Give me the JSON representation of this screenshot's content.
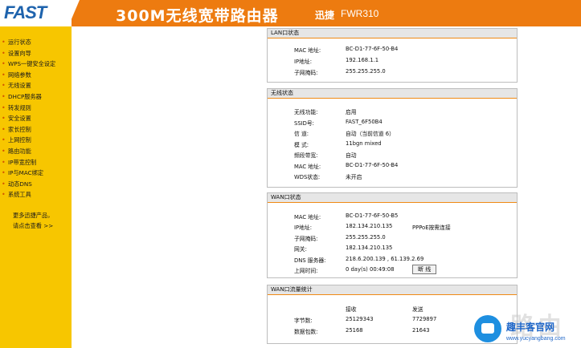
{
  "header": {
    "logo": "FAST",
    "title": "300M无线宽带路由器",
    "brand": "迅捷",
    "model": "FWR310"
  },
  "sidebar": {
    "items": [
      "运行状态",
      "设置向导",
      "WPS一键安全设定",
      "网络参数",
      "无线设置",
      "DHCP服务器",
      "转发规则",
      "安全设置",
      "家长控制",
      "上网控制",
      "路由功能",
      "IP带宽控制",
      "IP与MAC绑定",
      "动态DNS",
      "系统工具"
    ],
    "more_line1": "更多迅捷产品，",
    "more_line2": "请点击查看 >>"
  },
  "lan": {
    "title": "LAN口状态",
    "mac_label": "MAC 地址:",
    "mac": "BC-D1-77-6F-50-B4",
    "ip_label": "IP地址:",
    "ip": "192.168.1.1",
    "mask_label": "子网掩码:",
    "mask": "255.255.255.0"
  },
  "wireless": {
    "title": "无线状态",
    "func_label": "无线功能:",
    "func": "启用",
    "ssid_label": "SSID号:",
    "ssid": "FAST_6F50B4",
    "channel_label": "信 道:",
    "channel": "自动（当前信道 6）",
    "mode_label": "模 式:",
    "mode": "11bgn mixed",
    "bandwidth_label": "频段带宽:",
    "bandwidth": "自动",
    "mac_label": "MAC 地址:",
    "mac": "BC-D1-77-6F-50-B4",
    "wds_label": "WDS状态:",
    "wds": "未开启"
  },
  "wan": {
    "title": "WAN口状态",
    "mac_label": "MAC 地址:",
    "mac": "BC-D1-77-6F-50-B5",
    "ip_label": "IP地址:",
    "ip": "182.134.210.135",
    "conn_type": "PPPoE按需连接",
    "mask_label": "子网掩码:",
    "mask": "255.255.255.0",
    "gateway_label": "网关:",
    "gateway": "182.134.210.135",
    "dns_label": "DNS 服务器:",
    "dns": "218.6.200.139 , 61.139.2.69",
    "uptime_label": "上网时间:",
    "uptime": "0 day(s) 00:49:08",
    "disconnect_button": "断 线"
  },
  "traffic": {
    "title": "WAN口流量统计",
    "col_recv": "接收",
    "col_send": "发送",
    "bytes_label": "字节数:",
    "bytes_recv": "25129343",
    "bytes_send": "7729897",
    "packets_label": "数据包数:",
    "packets_recv": "25168",
    "packets_send": "21643"
  },
  "watermark": {
    "text": "路由",
    "brand": "趣丰客官网",
    "url": "www.yucyangbang.com"
  }
}
